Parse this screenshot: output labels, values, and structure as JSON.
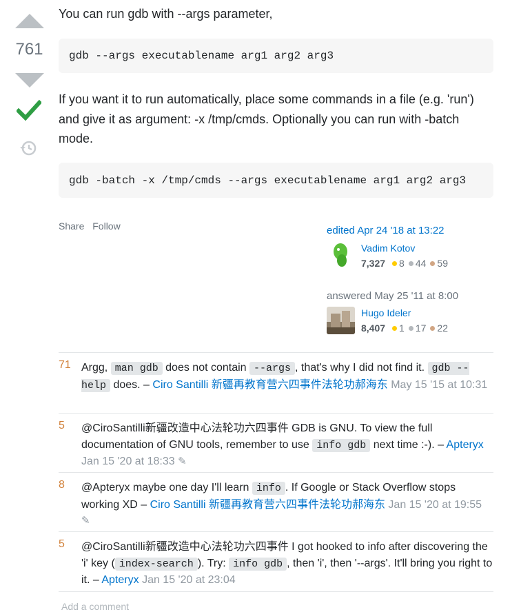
{
  "vote": {
    "count": "761",
    "accepted_icon": "checkmark-icon",
    "history_icon": "history-icon"
  },
  "answer": {
    "p1": "You can run gdb with --args parameter,",
    "code1": "gdb --args executablename arg1 arg2 arg3",
    "p2": "If you want it to run automatically, place some commands in a file (e.g. 'run') and give it as argument: -x /tmp/cmds. Optionally you can run with -batch mode.",
    "code2": "gdb -batch -x /tmp/cmds --args executablename arg1 arg2 arg3"
  },
  "menu": {
    "share": "Share",
    "follow": "Follow"
  },
  "edited": {
    "label": "edited Apr 24 '18 at 13:22",
    "user": "Vadim Kotov",
    "rep": "7,327",
    "gold": "8",
    "silver": "44",
    "bronze": "59"
  },
  "answered": {
    "label": "answered",
    "time": "May 25 '11 at 8:00",
    "user": "Hugo Ideler",
    "rep": "8,407",
    "gold": "1",
    "silver": "17",
    "bronze": "22"
  },
  "comments": [
    {
      "score": "71",
      "t1": "Argg, ",
      "c1": "man gdb",
      "t2": " does not contain ",
      "c2": "--args",
      "t3": ", that's why I did not find it. ",
      "c3": "gdb --help",
      "t4": " does. – ",
      "user": "Ciro Santilli 新疆再教育营六四事件法轮功郝海东",
      "date": "May 15 '15 at 10:31"
    },
    {
      "score": "5",
      "t1": "@CiroSantilli新疆改造中心法轮功六四事件 GDB is GNU. To view the full documentation of GNU tools, remember to use ",
      "c1": "info gdb",
      "t2": " next time :-). – ",
      "user": "Apteryx",
      "date": "Jan 15 '20 at 18:33"
    },
    {
      "score": "8",
      "t1": "@Apteryx maybe one day I'll learn ",
      "c1": "info",
      "t2": ". If Google or Stack Overflow stops working XD – ",
      "user": "Ciro Santilli 新疆再教育营六四事件法轮功郝海东",
      "date": "Jan 15 '20 at 19:55"
    },
    {
      "score": "5",
      "t1": "@CiroSantilli新疆改造中心法轮功六四事件 I got hooked to info after discovering the 'i' key (",
      "c1": "index-search",
      "t2": "). Try: ",
      "c2": "info gdb",
      "t3": ", then 'i', then '--args'. It'll bring you right to it. – ",
      "user": "Apteryx",
      "date": "Jan 15 '20 at 23:04"
    }
  ],
  "add_comment": "Add a comment"
}
